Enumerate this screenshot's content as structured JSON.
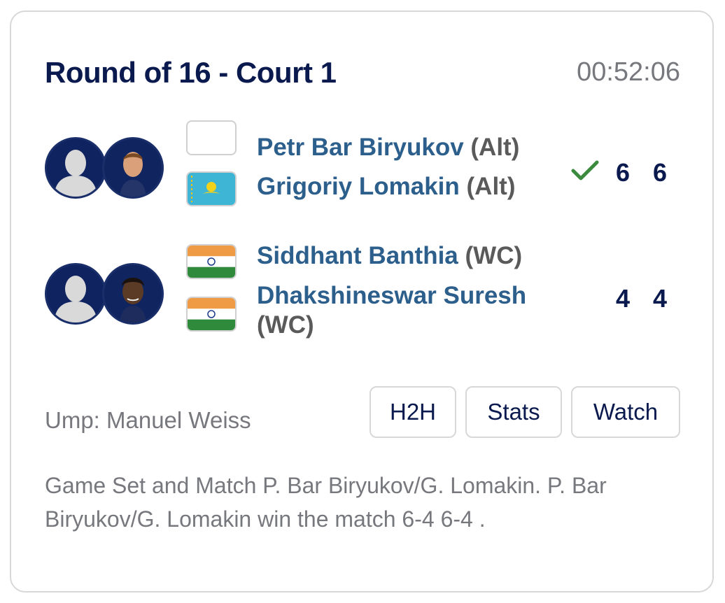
{
  "match": {
    "title": "Round of 16 - Court 1",
    "timer": "00:52:06"
  },
  "team1": {
    "players": [
      {
        "name": "Petr Bar Biryukov",
        "tag": "(Alt)",
        "flag": "blank"
      },
      {
        "name": "Grigoriy Lomakin",
        "tag": "(Alt)",
        "flag": "Kazakhstan"
      }
    ],
    "winner_icon": "check-icon",
    "scores": [
      "6",
      "6"
    ]
  },
  "team2": {
    "players": [
      {
        "name": "Siddhant Banthia",
        "tag": "(WC)",
        "flag": "India"
      },
      {
        "name": "Dhakshineswar Suresh",
        "tag": "(WC)",
        "flag": "India"
      }
    ],
    "scores": [
      "4",
      "4"
    ]
  },
  "umpire": "Ump: Manuel Weiss",
  "buttons": {
    "h2h": "H2H",
    "stats": "Stats",
    "watch": "Watch"
  },
  "summary": "Game Set and Match P. Bar Biryukov/G. Lomakin. P. Bar Biryukov/G. Lomakin win the match 6-4 6-4 .",
  "colors": {
    "navy": "#0a1a4f",
    "name_blue": "#2d5f8c",
    "grey_text": "#77787d",
    "check_green": "#3b8a3e"
  }
}
